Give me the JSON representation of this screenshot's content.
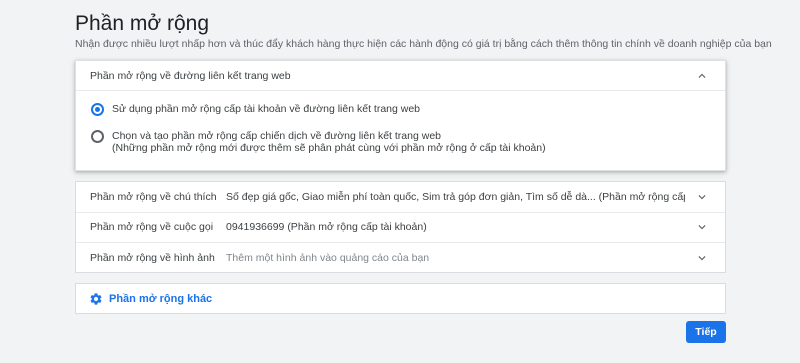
{
  "page": {
    "title": "Phần mở rộng",
    "subtitle": "Nhận được nhiều lượt nhấp hơn và thúc đẩy khách hàng thực hiện các hành động có giá trị bằng cách thêm thông tin chính về doanh nghiệp của bạn"
  },
  "sitelink_panel": {
    "title": "Phần mở rộng về đường liên kết trang web",
    "options": [
      {
        "label": "Sử dụng phần mở rộng cấp tài khoản về đường liên kết trang web",
        "selected": true
      },
      {
        "label": "Chọn và tạo phần mở rộng cấp chiến dịch về đường liên kết trang web",
        "sublabel": "(Những phần mở rộng mới được thêm sẽ phân phát cùng với phần mở rộng ở cấp tài khoản)",
        "selected": false
      }
    ]
  },
  "extensions": [
    {
      "label": "Phần mở rộng về chú thích",
      "value": "Số đẹp giá gốc, Giao miễn phí toàn quốc, Sim trả góp đơn giản, Tìm số dễ dà... (Phần mở rộng cấp tài khoản)"
    },
    {
      "label": "Phần mở rộng về cuộc gọi",
      "value": "0941936699 (Phần mở rộng cấp tài khoản)"
    },
    {
      "label": "Phần mở rộng về hình ảnh",
      "value": "Thêm một hình ảnh vào quảng cáo của bạn"
    }
  ],
  "more_extensions": {
    "label": "Phần mở rộng khác",
    "icon": "gear-icon"
  },
  "actions": {
    "next_label": "Tiếp"
  },
  "colors": {
    "accent": "#1a73e8",
    "background": "#f1f3f4"
  }
}
